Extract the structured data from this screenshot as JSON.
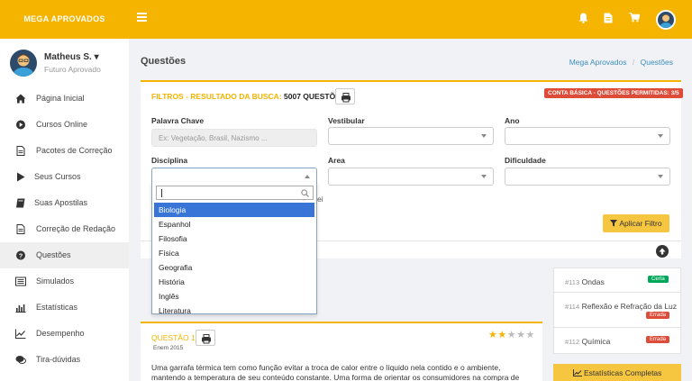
{
  "brand": "MEGA APROVADOS",
  "user": {
    "name": "Matheus S. ▾",
    "role": "Futuro Aprovado"
  },
  "nav": [
    {
      "label": "Página Inicial",
      "icon": "home-icon"
    },
    {
      "label": "Cursos Online",
      "icon": "play-circle-icon"
    },
    {
      "label": "Pacotes de Correção",
      "icon": "file-icon"
    },
    {
      "label": "Seus Cursos",
      "icon": "play-icon"
    },
    {
      "label": "Suas Apostilas",
      "icon": "book-icon"
    },
    {
      "label": "Correção de Redação",
      "icon": "file-text-icon"
    },
    {
      "label": "Questões",
      "icon": "question-circle-icon"
    },
    {
      "label": "Simulados",
      "icon": "list-icon"
    },
    {
      "label": "Estatísticas",
      "icon": "bar-chart-icon"
    },
    {
      "label": "Desempenho",
      "icon": "line-chart-icon"
    },
    {
      "label": "Tira-dúvidas",
      "icon": "comments-icon"
    }
  ],
  "page": {
    "title": "Questões",
    "breadcrumb": {
      "home": "Mega Aprovados",
      "sep": "/",
      "current": "Questões"
    }
  },
  "filter": {
    "title_prefix": "FILTROS - RESULTADO DA BUSCA:",
    "title_count": "5007 QUESTÕES -",
    "plan_badge": "CONTA BÁSICA - QUESTÕES PERMITIDAS: 3/5",
    "keyword_label": "Palavra Chave",
    "keyword_placeholder": "Ex: Vegetação, Brasil, Nazismo ...",
    "vestibular_label": "Vestibular",
    "ano_label": "Ano",
    "disciplina_label": "Disciplina",
    "area_label": "Area",
    "dificuldade_label": "Dificuldade",
    "apply_label": "Aplicar Filtro",
    "behind_text": "ei"
  },
  "dropdown": {
    "options": [
      "Biologia",
      "Espanhol",
      "Filosofia",
      "Física",
      "Geografia",
      "História",
      "Inglês",
      "Literatura"
    ],
    "selected": "Biologia"
  },
  "question": {
    "number": "QUESTÃO 1",
    "exam": "Enem 2015",
    "rating": 2,
    "rating_max": 5,
    "text": "Uma garrafa térmica tem como função evitar a troca de calor entre o líquido nela contido e o ambiente, mantendo a temperatura de seu conteúdo constante. Uma forma de orientar os consumidores na compra de uma garrafa"
  },
  "recent": [
    {
      "num": "#113",
      "name": "Ondas",
      "status": "Certa",
      "status_color": "#00a65a"
    },
    {
      "num": "#114",
      "name": "Reflexão e Refração da Luz",
      "status": "Errada",
      "status_color": "#dd4b39"
    },
    {
      "num": "#112",
      "name": "Química",
      "status": "Errada",
      "status_color": "#dd4b39"
    }
  ],
  "stats_button": "Estatísticas Completas",
  "colors": {
    "brand": "#f4b400",
    "selected": "#3875d7",
    "danger": "#dd4b39",
    "success": "#00a65a"
  }
}
